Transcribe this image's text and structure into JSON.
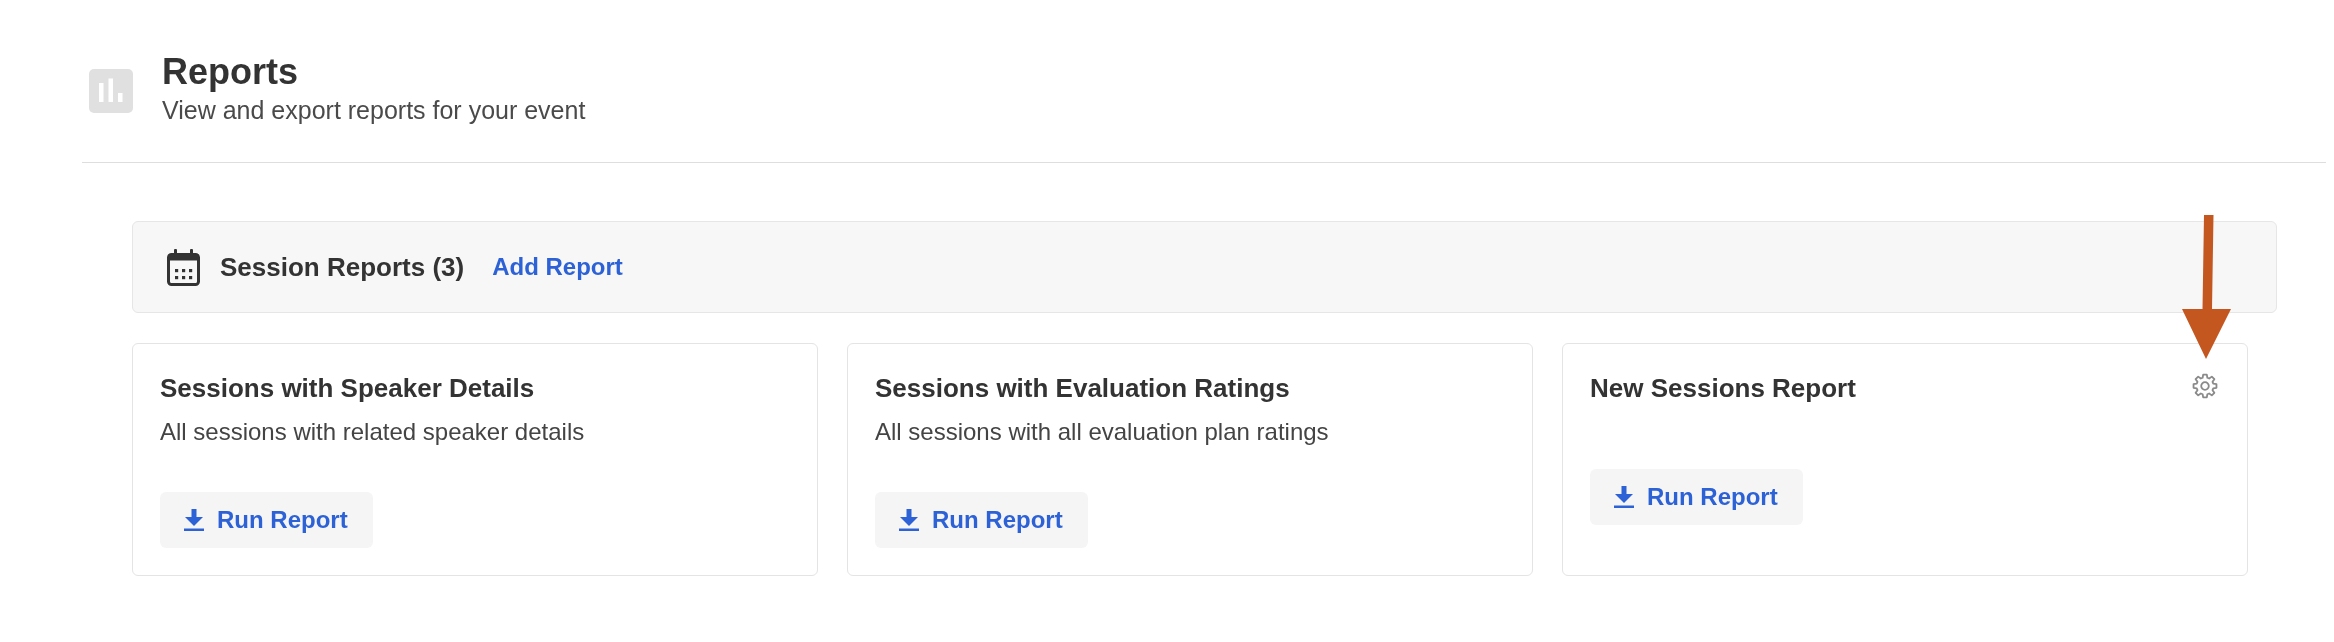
{
  "header": {
    "title": "Reports",
    "subtitle": "View and export reports for your event"
  },
  "section": {
    "title": "Session Reports (3)",
    "action": "Add Report"
  },
  "reports": [
    {
      "title": "Sessions with Speaker Details",
      "description": "All sessions with related speaker details",
      "button": "Run Report",
      "settings_icon": false
    },
    {
      "title": "Sessions with Evaluation Ratings",
      "description": "All sessions with all evaluation plan ratings",
      "button": "Run Report",
      "settings_icon": false
    },
    {
      "title": "New Sessions Report",
      "button": "Run Report",
      "settings_icon": true
    }
  ],
  "annotation": {
    "kind": "arrow"
  }
}
